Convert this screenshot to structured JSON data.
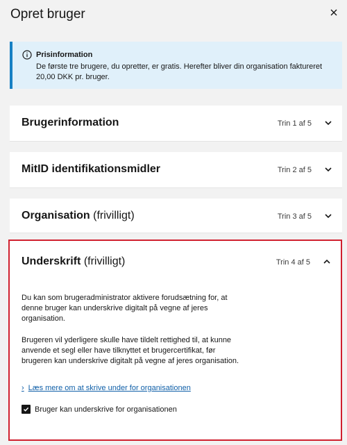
{
  "dialog": {
    "title": "Opret bruger"
  },
  "notice": {
    "heading": "Prisinformation",
    "body": "De første tre brugere, du opretter, er gratis. Herefter bliver din organisation faktureret 20,00 DKK pr. bruger."
  },
  "steps": [
    {
      "title": "Brugerinformation",
      "optional": "",
      "step": "Trin 1 af 5"
    },
    {
      "title": "MitID identifikationsmidler",
      "optional": "",
      "step": "Trin 2 af 5"
    },
    {
      "title": "Organisation",
      "optional": "(frivilligt)",
      "step": "Trin 3 af 5"
    },
    {
      "title": "Underskrift",
      "optional": "(frivilligt)",
      "step": "Trin 4 af 5",
      "paragraph1": "Du kan som brugeradministrator aktivere forudsætning for, at denne bruger kan underskrive digitalt på vegne af jeres organisation.",
      "paragraph2": "Brugeren vil yderligere skulle have tildelt rettighed til, at kunne anvende et segl eller have tilknyttet et brugercertifikat, før brugeren kan underskrive digitalt på vegne af jeres organisation.",
      "link": "Læs mere om at skrive under for organisationen",
      "checkbox_label": "Bruger kan underskrive for organisationen",
      "checkbox_checked": true
    }
  ],
  "colors": {
    "accent": "#1680c4",
    "notice_bg": "#e0f0fa",
    "highlight_border": "#d0202f"
  }
}
